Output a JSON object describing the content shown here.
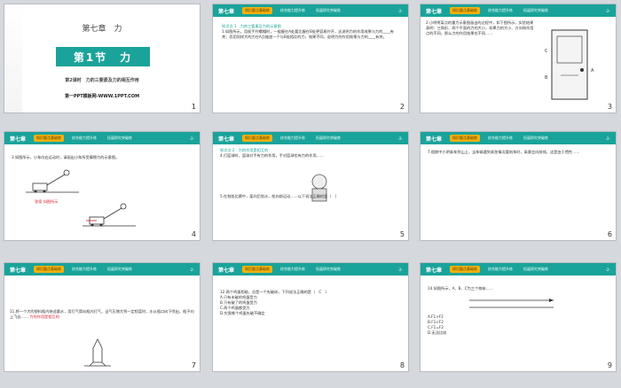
{
  "slides": [
    {
      "num": "1",
      "chapter_title": "第七章　力",
      "section": "第1节　力",
      "subtitle": "第2课时　力的三要素及力的相互作用",
      "site": "第一PPT模板网-WWW.1PPT.COM"
    },
    {
      "num": "2",
      "body": "知识点 1　力的三要素及力的示意图",
      "text": "1.如图所示，用扳手拧螺帽时，一般握在A处要比握在B处更容易拧开，这说明力的作用效果与力的____有关；而用同样大的力在A点施加一个与B处相反的力，效果不同，说明力的作用效果与力的____有关。"
    },
    {
      "num": "3",
      "text": "2.小明将某点的重力示意图画出的过程中，如下图所示，实验结果表明：三角形、两个平面的力的大小，如果力的大小、方向和作用点的不同，那么力的作用效果也不同……"
    },
    {
      "num": "4",
      "text": "3.如图所示，小车向右运动时，请画出小车所受摩擦力的示意图。",
      "caption": "答案 如图所示"
    },
    {
      "num": "5",
      "body": "知识点 2　力的作用是相互的",
      "text": "4.打篮球时，篮球对手有力的作用，手对篮球也有力的作用……",
      "text2": "5.在划船比赛中，桨向后划水，船向前运动……以下说法正确的是（　）"
    },
    {
      "num": "6",
      "text": "7.假期中小明乘车到山上，当车辆遇到紧急情况要刹车时，乘客会向前倾，这是由于惯性……"
    },
    {
      "num": "7",
      "text": "11.将一个大的塑料瓶内装适量水，用打气筒向瓶内打气，当气压增大到一定程度时，水从瓶口向下喷出，瓶子向上飞去……",
      "answer": "力的作用是相互的"
    },
    {
      "num": "8",
      "text": "12.两个鸡蛋相碰，总是一个先破碎，下列说法正确的是（　C　）",
      "choices": [
        "A.只有未破的鸡蛋受力",
        "B.只有破了的鸡蛋受力",
        "C.两个鸡蛋都受力",
        "D.究竟哪个鸡蛋先破不确定"
      ]
    },
    {
      "num": "9",
      "text": "14.如图所示，A、B、C为三个物体……",
      "choices": [
        "A.F1>F2",
        "B.F1<F2",
        "C.F1=F2",
        "D.无法比较"
      ]
    }
  ],
  "header": {
    "chapter": "第七章",
    "tab1": "知识要点基础练",
    "tab2": "综合能力提升练",
    "tab3": "拓展探究突破练",
    "page_marker": "-2-"
  }
}
